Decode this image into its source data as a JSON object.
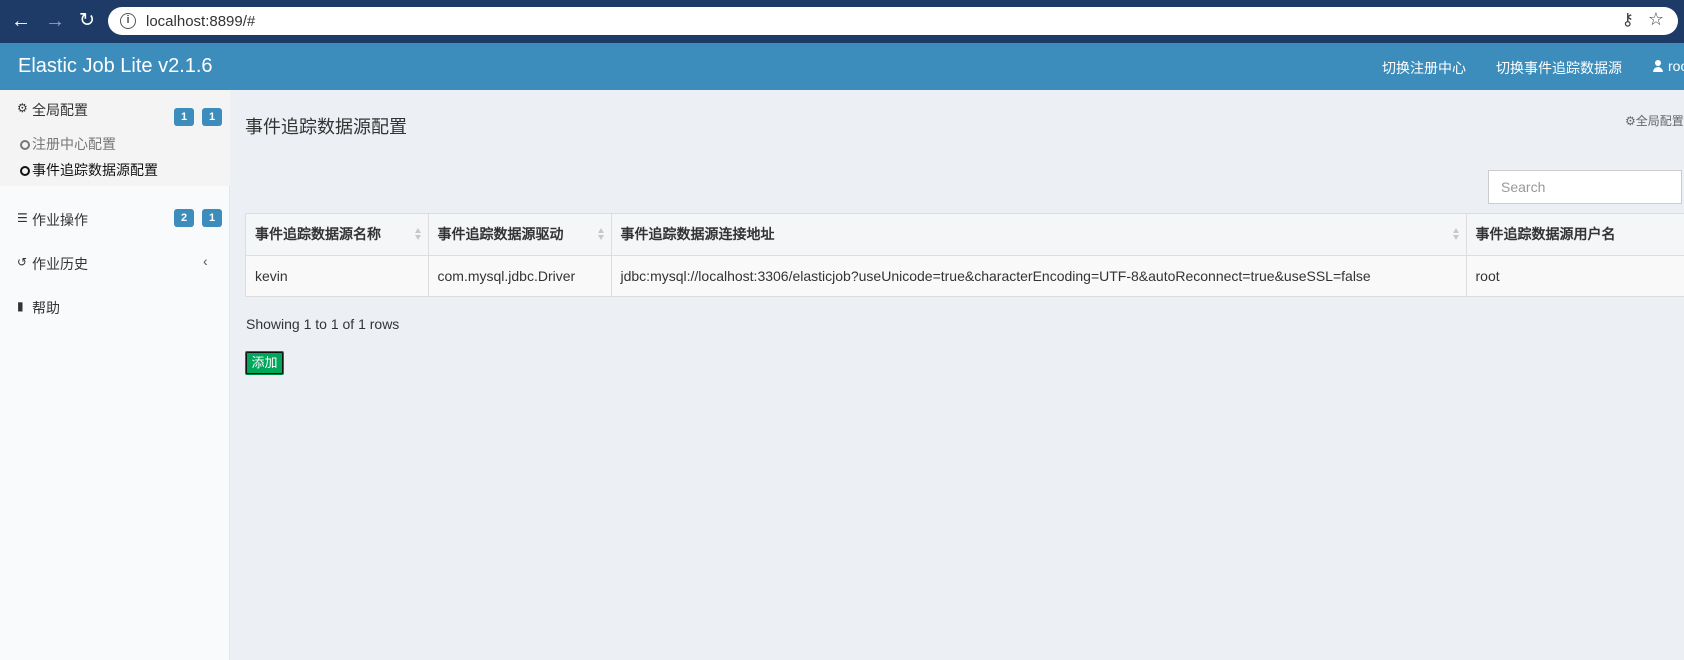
{
  "browser": {
    "url": "localhost:8899/#",
    "icons": {
      "back": "arrow-left-icon",
      "forward": "arrow-right-icon",
      "reload": "reload-icon",
      "info": "info-icon",
      "key": "key-icon",
      "star": "star-icon"
    }
  },
  "header": {
    "brand": "Elastic Job Lite v2.1.6",
    "links": [
      "切换注册中心",
      "切换事件追踪数据源"
    ],
    "user": "root"
  },
  "sidebar": {
    "global": {
      "label": "全局配置",
      "badges": [
        "1",
        "1"
      ]
    },
    "submenu": [
      "注册中心配置",
      "事件追踪数据源配置"
    ],
    "ops": {
      "label": "作业操作",
      "badges": [
        "2",
        "1"
      ]
    },
    "history": {
      "label": "作业历史",
      "chevron": "‹"
    },
    "help": {
      "label": "帮助"
    }
  },
  "main": {
    "title": "事件追踪数据源配置",
    "breadcrumb": "全局配置",
    "search_placeholder": "Search",
    "columns": [
      "事件追踪数据源名称",
      "事件追踪数据源驱动",
      "事件追踪数据源连接地址",
      "事件追踪数据源用户名"
    ],
    "rows": [
      [
        "kevin",
        "com.mysql.jdbc.Driver",
        "jdbc:mysql://localhost:3306/elasticjob?useUnicode=true&characterEncoding=UTF-8&autoReconnect=true&useSSL=false",
        "root"
      ]
    ],
    "showing": "Showing 1 to 1 of 1 rows",
    "add_label": "添加"
  }
}
